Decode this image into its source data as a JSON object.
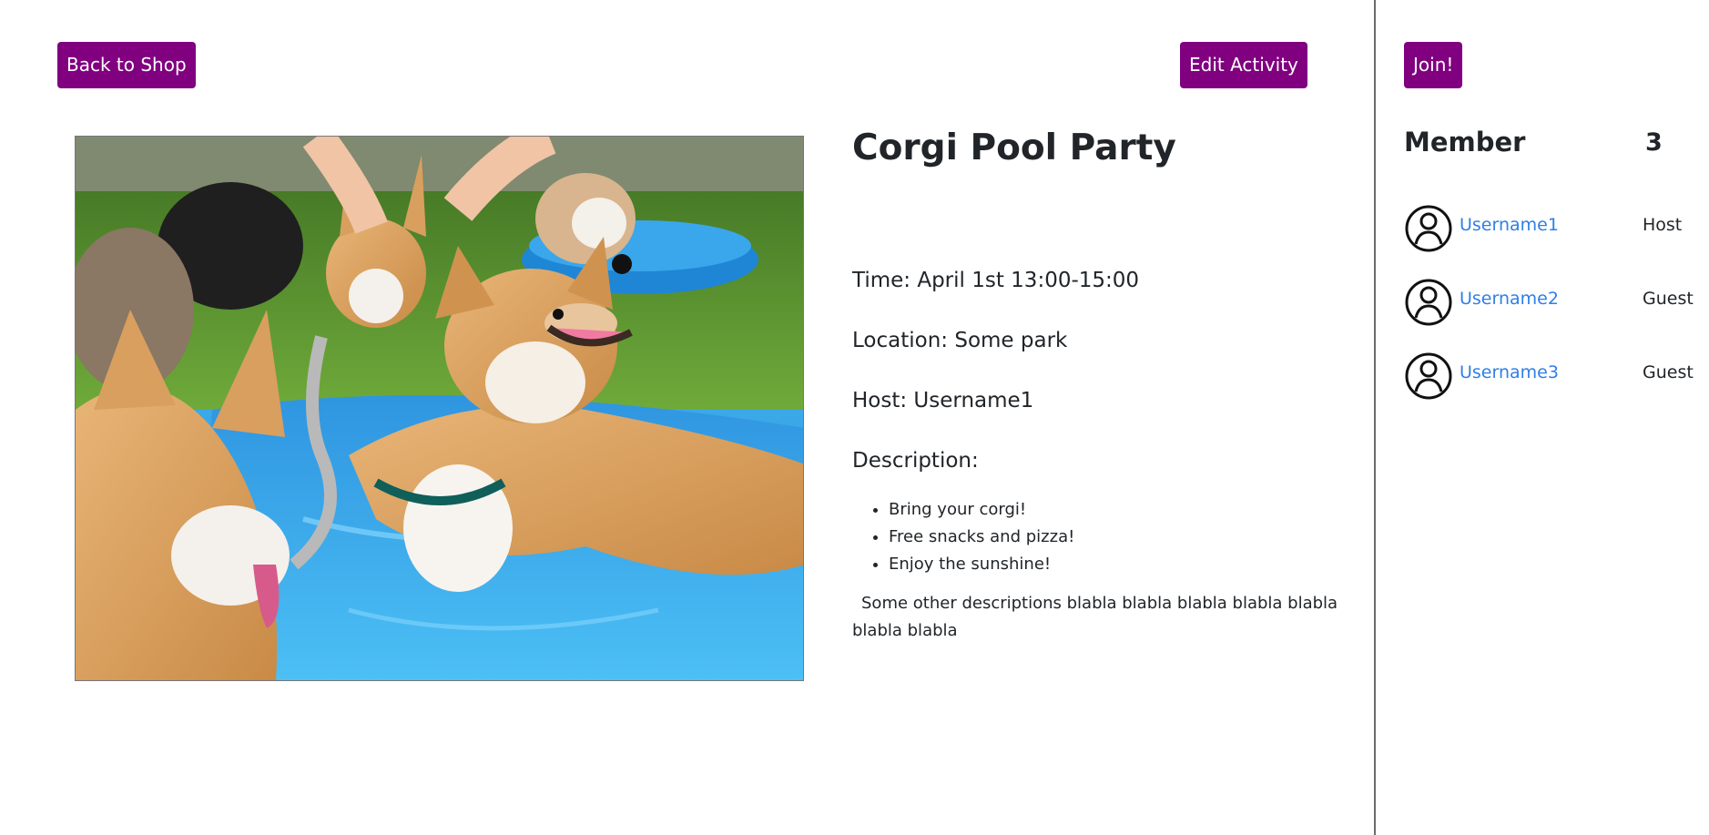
{
  "toolbar": {
    "back_label": "Back to Shop",
    "edit_label": "Edit Activity"
  },
  "activity": {
    "title": "Corgi Pool Party",
    "time": "Time: April 1st 13:00-15:00",
    "location": "Location: Some park",
    "host": "Host: Username1",
    "description_label": "Description:",
    "description_items": [
      "Bring your corgi!",
      "Free snacks and pizza!",
      "Enjoy the sunshine!"
    ],
    "description_extra": "Some other descriptions blabla blabla blabla blabla blabla blabla blabla",
    "photo_icon": "corgi-pool-photo"
  },
  "sidebar": {
    "join_label": "Join!",
    "member_heading": "Member",
    "member_count": "3",
    "members": [
      {
        "name": "Username1",
        "role": "Host",
        "icon": "user-avatar-icon"
      },
      {
        "name": "Username2",
        "role": "Guest",
        "icon": "user-avatar-icon"
      },
      {
        "name": "Username3",
        "role": "Guest",
        "icon": "user-avatar-icon"
      }
    ]
  },
  "colors": {
    "button": "#800080",
    "link": "#2f7fe6",
    "divider": "#6c6c6c"
  }
}
